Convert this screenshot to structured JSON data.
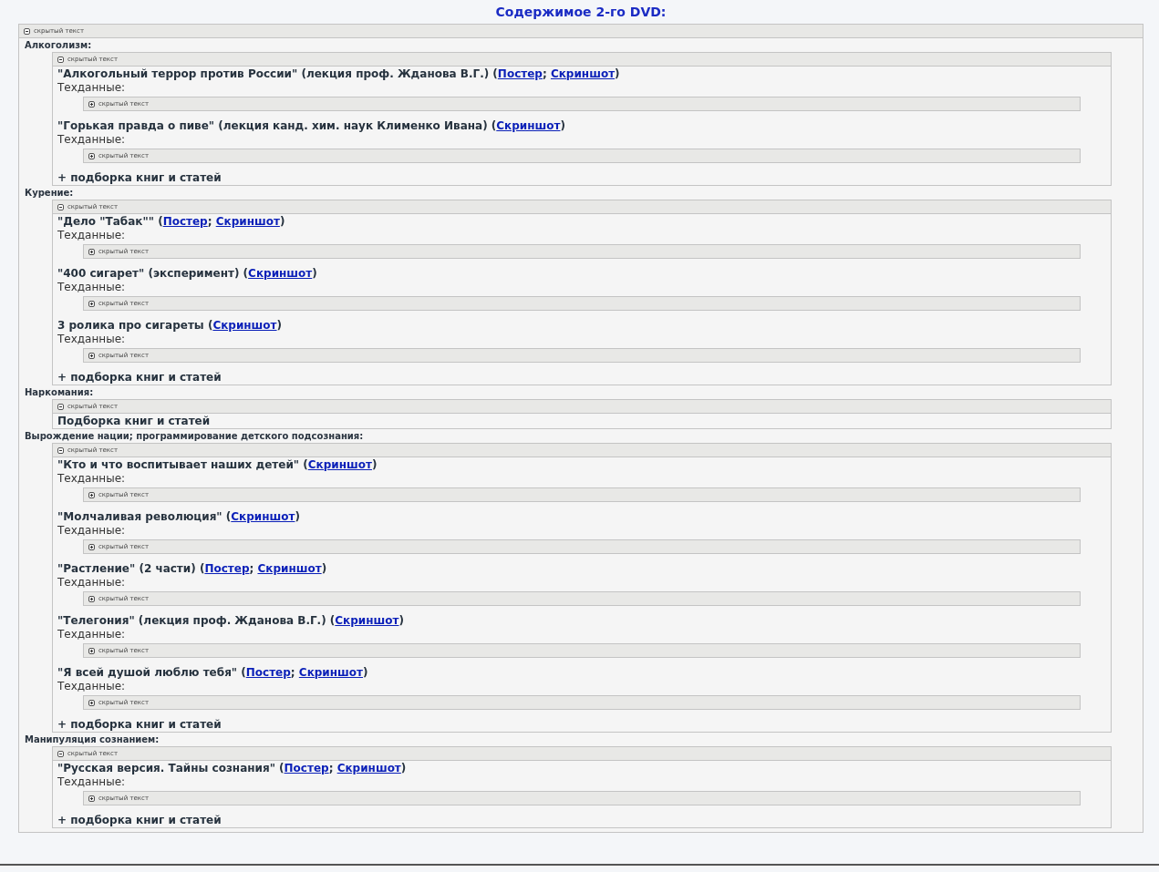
{
  "title": "Содержимое 2-го DVD:",
  "spoiler": {
    "label": "скрытый текст",
    "expanded": true
  },
  "sections": [
    {
      "heading": "Алкоголизм:",
      "spoiler": {
        "label": "скрытый текст",
        "expanded": true
      },
      "items": [
        {
          "parts": [
            {
              "kind": "text",
              "text": "\"Алкогольный террор против России\" (лекция проф. Жданова В.Г.) ("
            },
            {
              "kind": "link",
              "text": "Постер"
            },
            {
              "kind": "text",
              "text": "; "
            },
            {
              "kind": "link",
              "text": "Скриншот"
            },
            {
              "kind": "text",
              "text": ")"
            }
          ],
          "tech_label": "Техданные:",
          "tech_spoiler": {
            "label": "скрытый текст",
            "expanded": false
          }
        },
        {
          "parts": [
            {
              "kind": "text",
              "text": "\"Горькая правда о пиве\" (лекция канд. хим. наук Клименко Ивана) ("
            },
            {
              "kind": "link",
              "text": "Скриншот"
            },
            {
              "kind": "text",
              "text": ")"
            }
          ],
          "tech_label": "Техданные:",
          "tech_spoiler": {
            "label": "скрытый текст",
            "expanded": false
          }
        }
      ],
      "footer": "+ подборка книг и статей"
    },
    {
      "heading": "Курение:",
      "spoiler": {
        "label": "скрытый текст",
        "expanded": true
      },
      "items": [
        {
          "parts": [
            {
              "kind": "text",
              "text": "\"Дело \"Табак\"\" ("
            },
            {
              "kind": "link",
              "text": "Постер"
            },
            {
              "kind": "text",
              "text": "; "
            },
            {
              "kind": "link",
              "text": "Скриншот"
            },
            {
              "kind": "text",
              "text": ")"
            }
          ],
          "tech_label": "Техданные:",
          "tech_spoiler": {
            "label": "скрытый текст",
            "expanded": false
          }
        },
        {
          "parts": [
            {
              "kind": "text",
              "text": "\"400 сигарет\" (эксперимент) ("
            },
            {
              "kind": "link",
              "text": "Скриншот"
            },
            {
              "kind": "text",
              "text": ")"
            }
          ],
          "tech_label": "Техданные:",
          "tech_spoiler": {
            "label": "скрытый текст",
            "expanded": false
          }
        },
        {
          "parts": [
            {
              "kind": "text",
              "text": "3 ролика про сигареты ("
            },
            {
              "kind": "link",
              "text": "Скриншот"
            },
            {
              "kind": "text",
              "text": ")"
            }
          ],
          "tech_label": "Техданные:",
          "tech_spoiler": {
            "label": "скрытый текст",
            "expanded": false
          }
        }
      ],
      "footer": "+ подборка книг и статей"
    },
    {
      "heading": "Наркомания:",
      "spoiler": {
        "label": "скрытый текст",
        "expanded": true
      },
      "footer": "Подборка книг и статей"
    },
    {
      "heading": "Вырождение нации; программирование детского подсознания:",
      "spoiler": {
        "label": "скрытый текст",
        "expanded": true
      },
      "items": [
        {
          "parts": [
            {
              "kind": "text",
              "text": "\"Кто и что воспитывает наших детей\" ("
            },
            {
              "kind": "link",
              "text": "Скриншот"
            },
            {
              "kind": "text",
              "text": ")"
            }
          ],
          "tech_label": "Техданные:",
          "tech_spoiler": {
            "label": "скрытый текст",
            "expanded": false
          }
        },
        {
          "parts": [
            {
              "kind": "text",
              "text": "\"Молчаливая революция\" ("
            },
            {
              "kind": "link",
              "text": "Скриншот"
            },
            {
              "kind": "text",
              "text": ")"
            }
          ],
          "tech_label": "Техданные:",
          "tech_spoiler": {
            "label": "скрытый текст",
            "expanded": false
          }
        },
        {
          "parts": [
            {
              "kind": "text",
              "text": "\"Растление\" (2 части) ("
            },
            {
              "kind": "link",
              "text": "Постер"
            },
            {
              "kind": "text",
              "text": "; "
            },
            {
              "kind": "link",
              "text": "Скриншот"
            },
            {
              "kind": "text",
              "text": ")"
            }
          ],
          "tech_label": "Техданные:",
          "tech_spoiler": {
            "label": "скрытый текст",
            "expanded": false
          }
        },
        {
          "parts": [
            {
              "kind": "text",
              "text": "\"Телегония\" (лекция проф. Жданова В.Г.) ("
            },
            {
              "kind": "link",
              "text": "Скриншот"
            },
            {
              "kind": "text",
              "text": ")"
            }
          ],
          "tech_label": "Техданные:",
          "tech_spoiler": {
            "label": "скрытый текст",
            "expanded": false
          }
        },
        {
          "parts": [
            {
              "kind": "text",
              "text": "\"Я всей душой люблю тебя\" ("
            },
            {
              "kind": "link",
              "text": "Постер"
            },
            {
              "kind": "text",
              "text": "; "
            },
            {
              "kind": "link",
              "text": "Скриншот"
            },
            {
              "kind": "text",
              "text": ")"
            }
          ],
          "tech_label": "Техданные:",
          "tech_spoiler": {
            "label": "скрытый текст",
            "expanded": false
          }
        }
      ],
      "footer": "+ подборка книг и статей"
    },
    {
      "heading": "Манипуляция сознанием:",
      "spoiler": {
        "label": "скрытый текст",
        "expanded": true
      },
      "items": [
        {
          "parts": [
            {
              "kind": "text",
              "text": "\"Русская версия. Тайны сознания\" ("
            },
            {
              "kind": "link",
              "text": "Постер"
            },
            {
              "kind": "text",
              "text": "; "
            },
            {
              "kind": "link",
              "text": "Скриншот"
            },
            {
              "kind": "text",
              "text": ")"
            }
          ],
          "tech_label": "Техданные:",
          "tech_spoiler": {
            "label": "скрытый текст",
            "expanded": false
          }
        }
      ],
      "footer": "+ подборка книг и статей"
    }
  ]
}
